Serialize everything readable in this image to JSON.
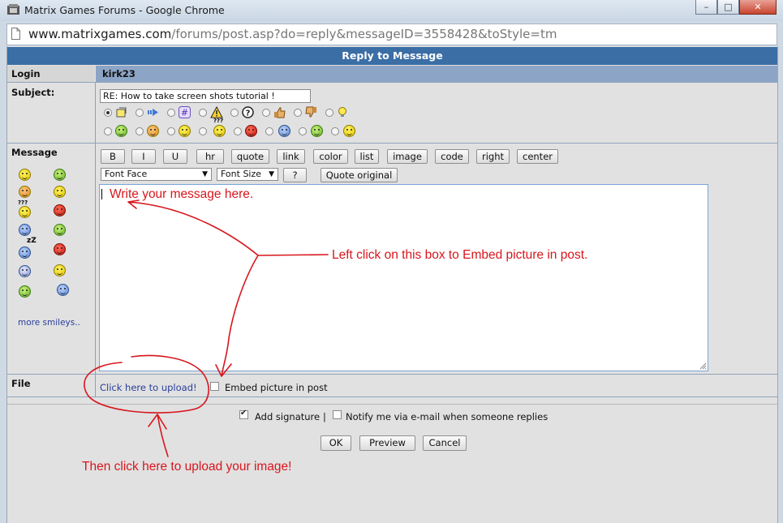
{
  "window": {
    "title": "Matrix Games Forums - Google Chrome",
    "url_domain": "www.matrixgames.com",
    "url_path": "/forums/post.asp?do=reply&messageID=3558428&toStyle=tm"
  },
  "form": {
    "header": "Reply to Message",
    "login_label": "Login",
    "login_value": "kirk23",
    "subject_label": "Subject:",
    "subject_value": "RE: How to take screen shots tutorial !",
    "message_label": "Message",
    "file_label": "File",
    "more_smileys": "more smileys..",
    "toolbar_buttons": [
      "B",
      "I",
      "U",
      "hr",
      "quote",
      "link",
      "color",
      "list",
      "image",
      "code",
      "right",
      "center"
    ],
    "font_face": "Font Face",
    "font_size": "Font Size",
    "help_button": "?",
    "quote_original": "Quote original",
    "upload_link": "Click here to upload!",
    "embed_label": "Embed picture in post",
    "add_signature": "Add signature",
    "separator": "|",
    "notify_label": "Notify me via e-mail when someone replies",
    "ok": "OK",
    "preview": "Preview",
    "cancel": "Cancel",
    "window_controls": {
      "minimize": "–",
      "maximize": "□",
      "close": "✕"
    },
    "icons": [
      "post-icon",
      "arrow-icon",
      "hash-icon",
      "warning-icon",
      "question-icon",
      "thumbs-up-icon",
      "thumbs-down-icon",
      "lightbulb-icon"
    ]
  },
  "annotations": {
    "write_message": "Write your message here.",
    "left_click": "Left click on this box to Embed picture in post.",
    "then_click": "Then click here to upload your image!"
  },
  "colors": {
    "header": "#3a6ea5",
    "login_bar": "#8ca4c6",
    "annotation": "#d8161d",
    "link": "#2a3f9a"
  }
}
